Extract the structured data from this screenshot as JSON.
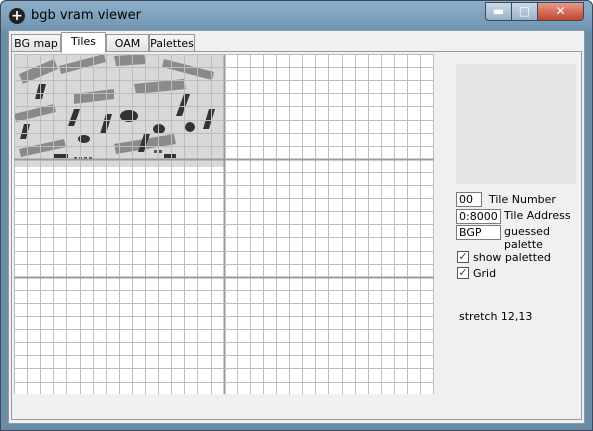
{
  "window": {
    "title": "bgb vram viewer"
  },
  "titlebar_buttons": {
    "minimize": "▬",
    "maximize": "□",
    "close": "✕"
  },
  "tabs": [
    "BG map",
    "Tiles",
    "OAM",
    "Palettes"
  ],
  "active_tab": "Tiles",
  "tile_info": {
    "tile_number": "00",
    "tile_number_label": "Tile Number",
    "tile_address": "0:8000",
    "tile_address_label": "Tile Address",
    "palette": "BGP",
    "palette_label": "guessed palette"
  },
  "options": {
    "show_paletted_label": "show paletted",
    "show_paletted_checked": true,
    "grid_label": "Grid",
    "grid_checked": true
  },
  "stretch_text": "stretch 12,13",
  "colors": {
    "titlebar": "#7fa2bd",
    "close": "#c44530",
    "grid_line": "#bdbdbd",
    "grid_major": "#9a9a9a"
  }
}
